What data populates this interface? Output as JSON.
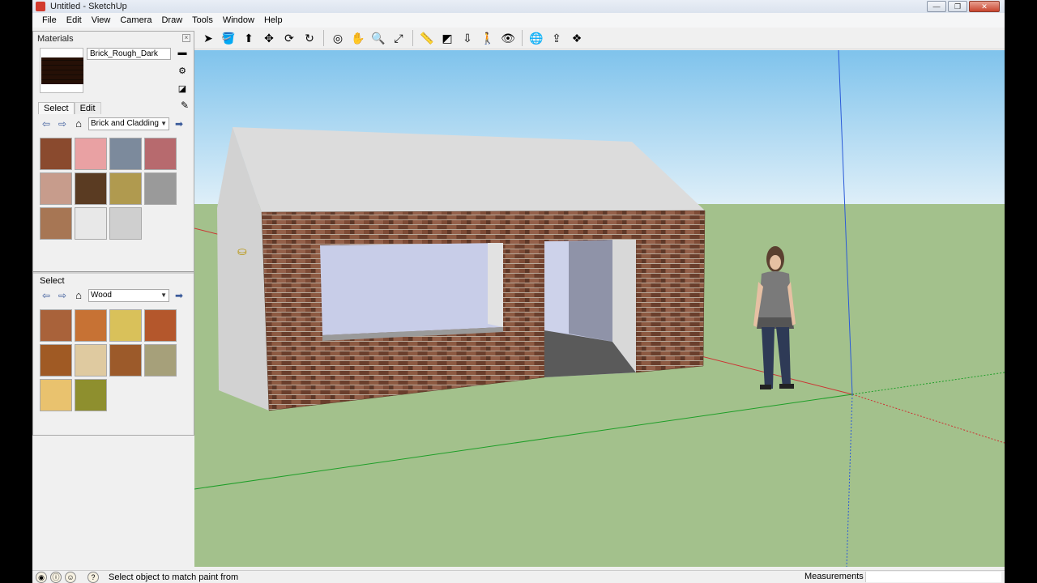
{
  "window": {
    "title": "Untitled - SketchUp",
    "controls": {
      "minimize": "—",
      "maximize": "❐",
      "close": "✕"
    }
  },
  "menu": [
    "File",
    "Edit",
    "View",
    "Camera",
    "Draw",
    "Tools",
    "Window",
    "Help"
  ],
  "toolbar": {
    "tools": [
      {
        "icon": "select-arrow-icon",
        "glyph": "➤"
      },
      {
        "icon": "paint-bucket-icon",
        "glyph": "🪣"
      },
      {
        "icon": "push-pull-icon",
        "glyph": "⬆"
      },
      {
        "icon": "move-icon",
        "glyph": "✥"
      },
      {
        "icon": "rotate-icon",
        "glyph": "⟳"
      },
      {
        "icon": "follow-me-icon",
        "glyph": "↻"
      },
      {
        "icon": "orbit-icon",
        "glyph": "◎"
      },
      {
        "icon": "pan-icon",
        "glyph": "✋"
      },
      {
        "icon": "zoom-icon",
        "glyph": "🔍"
      },
      {
        "icon": "zoom-extents-icon",
        "glyph": "⤢"
      },
      {
        "icon": "tape-measure-icon",
        "glyph": "📏"
      },
      {
        "icon": "section-plane-icon",
        "glyph": "◩"
      },
      {
        "icon": "position-camera-icon",
        "glyph": "⇩"
      },
      {
        "icon": "walk-icon",
        "glyph": "🚶"
      },
      {
        "icon": "look-around-icon",
        "glyph": "👁"
      },
      {
        "icon": "get-models-icon",
        "glyph": "🌐"
      },
      {
        "icon": "share-model-icon",
        "glyph": "⇪"
      },
      {
        "icon": "components-icon",
        "glyph": "❖"
      }
    ]
  },
  "materials": {
    "panel_title": "Materials",
    "close": "×",
    "current_name": "Brick_Rough_Dark",
    "tabs": [
      "Select",
      "Edit"
    ],
    "top_collection": "Brick and Cladding",
    "top_swatches": [
      {
        "name": "brick-red",
        "color": "#8a4a2e"
      },
      {
        "name": "brick-pink",
        "color": "#e9a1a3"
      },
      {
        "name": "stone-blue",
        "color": "#7c8a9c"
      },
      {
        "name": "brick-rose",
        "color": "#b76a6e"
      },
      {
        "name": "brick-light",
        "color": "#c79c8c"
      },
      {
        "name": "brick-dark",
        "color": "#5a3b22"
      },
      {
        "name": "stone-yellow",
        "color": "#b09a4f"
      },
      {
        "name": "block-gray",
        "color": "#9a9a9a"
      },
      {
        "name": "siding-brown",
        "color": "#a77654"
      },
      {
        "name": "siding-white",
        "color": "#e8e8e8"
      },
      {
        "name": "stucco-gray",
        "color": "#cfcfcf"
      }
    ],
    "bottom_label": "Select",
    "bottom_collection": "Wood",
    "bottom_swatches": [
      {
        "name": "wood-cherry",
        "color": "#a9623a"
      },
      {
        "name": "wood-orange",
        "color": "#c77234"
      },
      {
        "name": "wood-yellow",
        "color": "#d9c15a"
      },
      {
        "name": "wood-rust",
        "color": "#b4572c"
      },
      {
        "name": "wood-oak",
        "color": "#a05a24"
      },
      {
        "name": "wood-pale",
        "color": "#dfcaa0"
      },
      {
        "name": "wood-walnut",
        "color": "#9c5a2a"
      },
      {
        "name": "wood-olive",
        "color": "#a6a07a"
      },
      {
        "name": "wood-light",
        "color": "#e9c26e"
      },
      {
        "name": "wood-green",
        "color": "#8e8f2e"
      }
    ]
  },
  "colors": {
    "sky_top": "#7fc3ec",
    "sky_bottom": "#e3f1f9",
    "ground": "#a3c18c",
    "roof": "#dcdcdc",
    "wall": "#d2d2d2",
    "brick": "#7b4a35",
    "glass": "#c8cde8"
  },
  "status": {
    "message": "Select object to match paint from",
    "measurements_label": "Measurements",
    "icons": [
      "geo-location-icon",
      "credits-icon",
      "user-icon",
      "help-icon"
    ]
  }
}
